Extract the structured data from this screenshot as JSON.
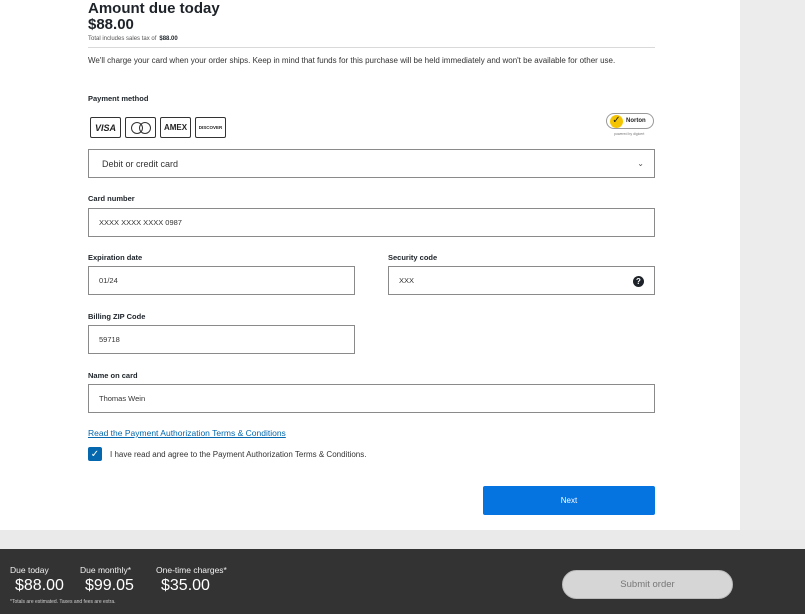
{
  "summary": {
    "title": "Amount due today",
    "amount": "$88.00",
    "tax_label": "Total includes sales tax of",
    "tax_amount": "$88.00",
    "notice": "We'll charge your card when your order ships. Keep in mind that funds for this purchase will be held immediately and won't be available for other use."
  },
  "payment": {
    "method_label": "Payment method",
    "logos": [
      "VISA",
      "MasterCard",
      "AMEX",
      "DISCOVER"
    ],
    "norton_label": "Norton",
    "norton_sub": "powered by digicert",
    "method_value": "Debit or credit card"
  },
  "fields": {
    "card_number_label": "Card number",
    "card_number_value": "XXXX XXXX XXXX 0987",
    "expiration_label": "Expiration date",
    "expiration_value": "01/24",
    "security_label": "Security code",
    "security_value": "XXX",
    "zip_label": "Billing ZIP Code",
    "zip_value": "59718",
    "name_label": "Name on card",
    "name_value": "Thomas Wein"
  },
  "terms": {
    "link": "Read the Payment Authorization Terms & Conditions",
    "agree": "I have read and agree to the Payment Authorization Terms & Conditions.",
    "checked": true
  },
  "actions": {
    "next": "Next",
    "submit": "Submit order"
  },
  "footer": {
    "due_today_label": "Due today",
    "due_today_value": "$88.00",
    "due_monthly_label": "Due monthly*",
    "due_monthly_value": "$99.05",
    "one_time_label": "One-time charges*",
    "one_time_value": "$35.00",
    "note": "*Totals are estimated. Taxes and fees are extra."
  },
  "colors": {
    "accent": "#0573e0",
    "link": "#0568ae",
    "footer_bg": "#333333"
  }
}
